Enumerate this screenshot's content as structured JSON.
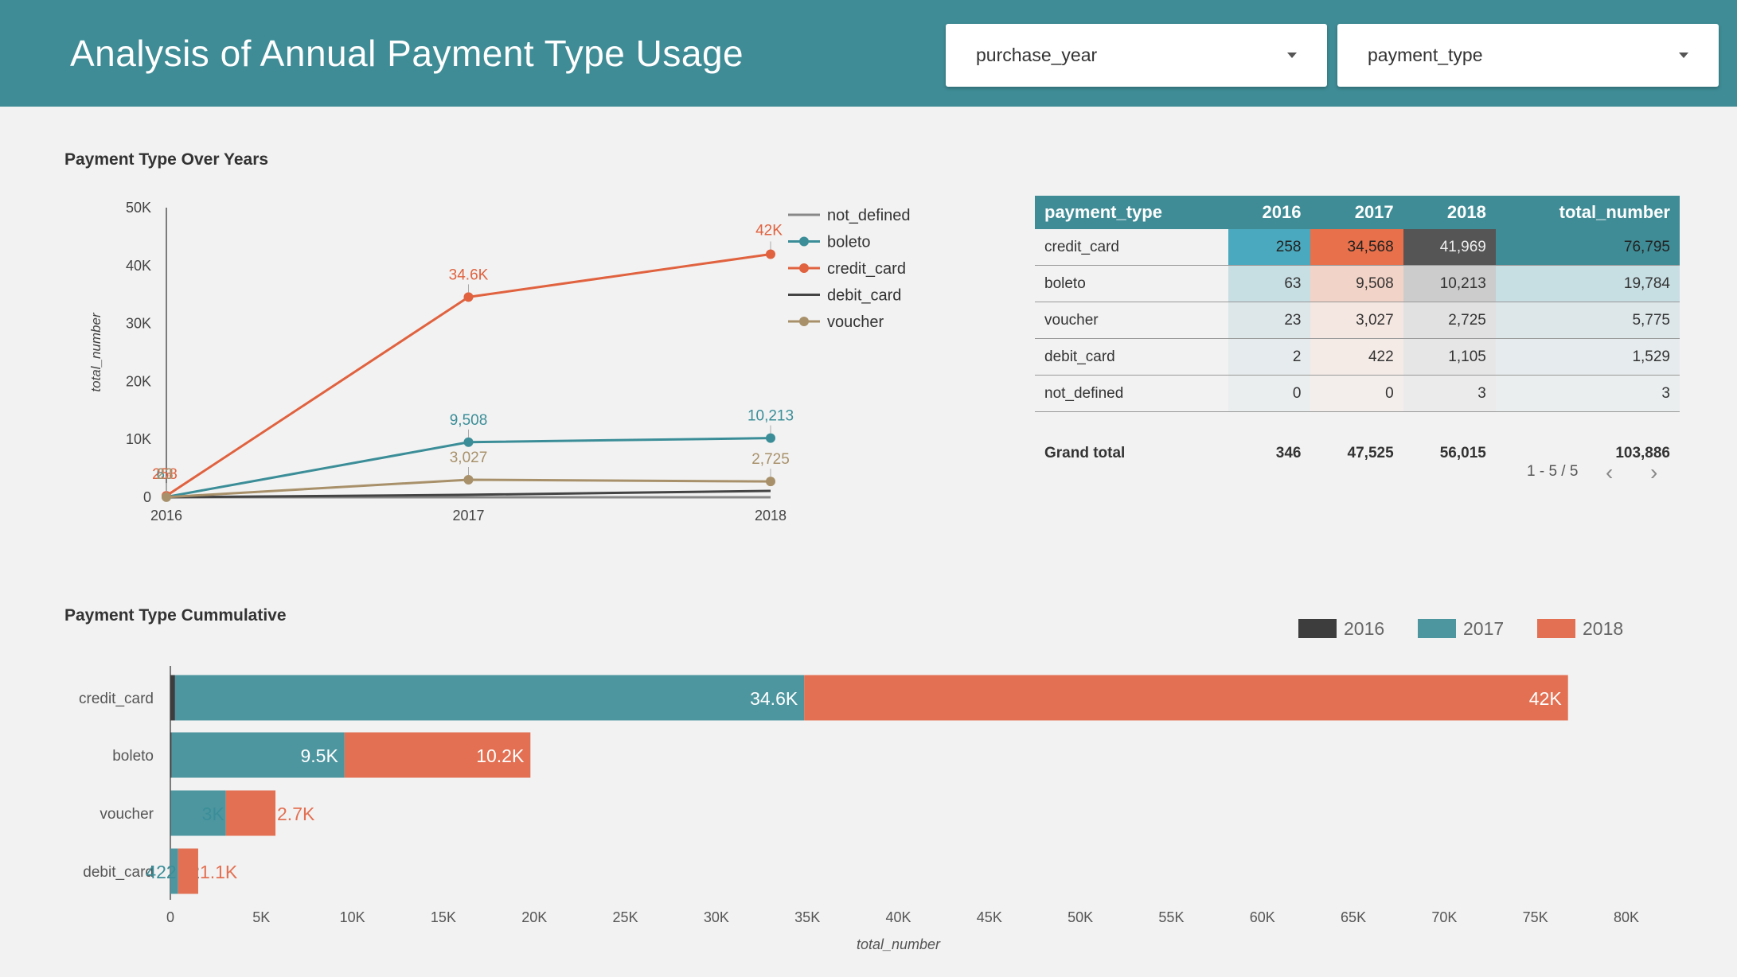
{
  "header": {
    "title": "Analysis of Annual Payment Type Usage",
    "filters": [
      {
        "label": "purchase_year"
      },
      {
        "label": "payment_type"
      }
    ]
  },
  "line_section": {
    "title": "Payment Type Over Years"
  },
  "table_section": {
    "columns": [
      "payment_type",
      "2016",
      "2017",
      "2018",
      "total_number"
    ],
    "rows": [
      {
        "cells": [
          "credit_card",
          "258",
          "34,568",
          "41,969",
          "76,795"
        ]
      },
      {
        "cells": [
          "boleto",
          "63",
          "9,508",
          "10,213",
          "19,784"
        ]
      },
      {
        "cells": [
          "voucher",
          "23",
          "3,027",
          "2,725",
          "5,775"
        ]
      },
      {
        "cells": [
          "debit_card",
          "2",
          "422",
          "1,105",
          "1,529"
        ]
      },
      {
        "cells": [
          "not_defined",
          "0",
          "0",
          "3",
          "3"
        ]
      }
    ],
    "grand_total": [
      "Grand total",
      "346",
      "47,525",
      "56,015",
      "103,886"
    ],
    "pagination": "1 - 5 / 5",
    "cell_colors": [
      [
        "#4aa9be",
        "#e8704a",
        "#555555",
        "#3f8c96"
      ],
      [
        "#c7dee3",
        "#f2d3c7",
        "#cccccc",
        "#c7dee3"
      ],
      [
        "#dde7ea",
        "#f4e6e0",
        "#e1e1e1",
        "#dde7ea"
      ],
      [
        "#e6ebed",
        "#f4ebe7",
        "#e6e6e6",
        "#e6ebed"
      ],
      [
        "#eaeeef",
        "#f3eeeb",
        "#ebebeb",
        "#eaeeef"
      ]
    ]
  },
  "bar_section": {
    "title": "Payment Type Cummulative"
  },
  "chart_data": [
    {
      "type": "line",
      "x": [
        "2016",
        "2017",
        "2018"
      ],
      "ylabel": "total_number",
      "ylim": [
        0,
        50000
      ],
      "yticks": [
        "0",
        "10K",
        "20K",
        "30K",
        "40K",
        "50K"
      ],
      "legend_position": "top-right",
      "series": [
        {
          "name": "not_defined",
          "values": [
            0,
            0,
            3
          ],
          "color": "#888888",
          "markers": false,
          "labels": [
            "",
            "",
            ""
          ]
        },
        {
          "name": "boleto",
          "values": [
            63,
            9508,
            10213
          ],
          "color": "#3b8e98",
          "markers": true,
          "labels": [
            "63",
            "9,508",
            "10,213"
          ]
        },
        {
          "name": "credit_card",
          "values": [
            258,
            34568,
            41969
          ],
          "color": "#e0623f",
          "markers": true,
          "labels": [
            "258",
            "34.6K",
            "42K"
          ]
        },
        {
          "name": "debit_card",
          "values": [
            2,
            422,
            1105
          ],
          "color": "#444444",
          "markers": false,
          "labels": [
            "",
            "",
            ""
          ]
        },
        {
          "name": "voucher",
          "values": [
            23,
            3027,
            2725
          ],
          "color": "#a8916a",
          "markers": true,
          "labels": [
            "23",
            "3,027",
            "2,725"
          ]
        }
      ]
    },
    {
      "type": "bar",
      "orientation": "horizontal",
      "stacked": true,
      "categories": [
        "credit_card",
        "boleto",
        "voucher",
        "debit_card"
      ],
      "xlabel": "total_number",
      "xlim": [
        0,
        80000
      ],
      "xticks": [
        "0",
        "5K",
        "10K",
        "15K",
        "20K",
        "25K",
        "30K",
        "35K",
        "40K",
        "45K",
        "50K",
        "55K",
        "60K",
        "65K",
        "70K",
        "75K",
        "80K"
      ],
      "legend_position": "top-right",
      "series": [
        {
          "name": "2016",
          "values": [
            258,
            63,
            23,
            2
          ],
          "color": "#3d3d3d",
          "labels": [
            "258",
            "63",
            "23",
            "2"
          ]
        },
        {
          "name": "2017",
          "values": [
            34568,
            9508,
            3027,
            422
          ],
          "color": "#4d96a0",
          "labels": [
            "34.6K",
            "9.5K",
            "3K",
            "422"
          ]
        },
        {
          "name": "2018",
          "values": [
            41969,
            10213,
            2725,
            1105
          ],
          "color": "#e37052",
          "labels": [
            "42K",
            "10.2K",
            "2.7K",
            "1.1K"
          ]
        }
      ]
    }
  ]
}
